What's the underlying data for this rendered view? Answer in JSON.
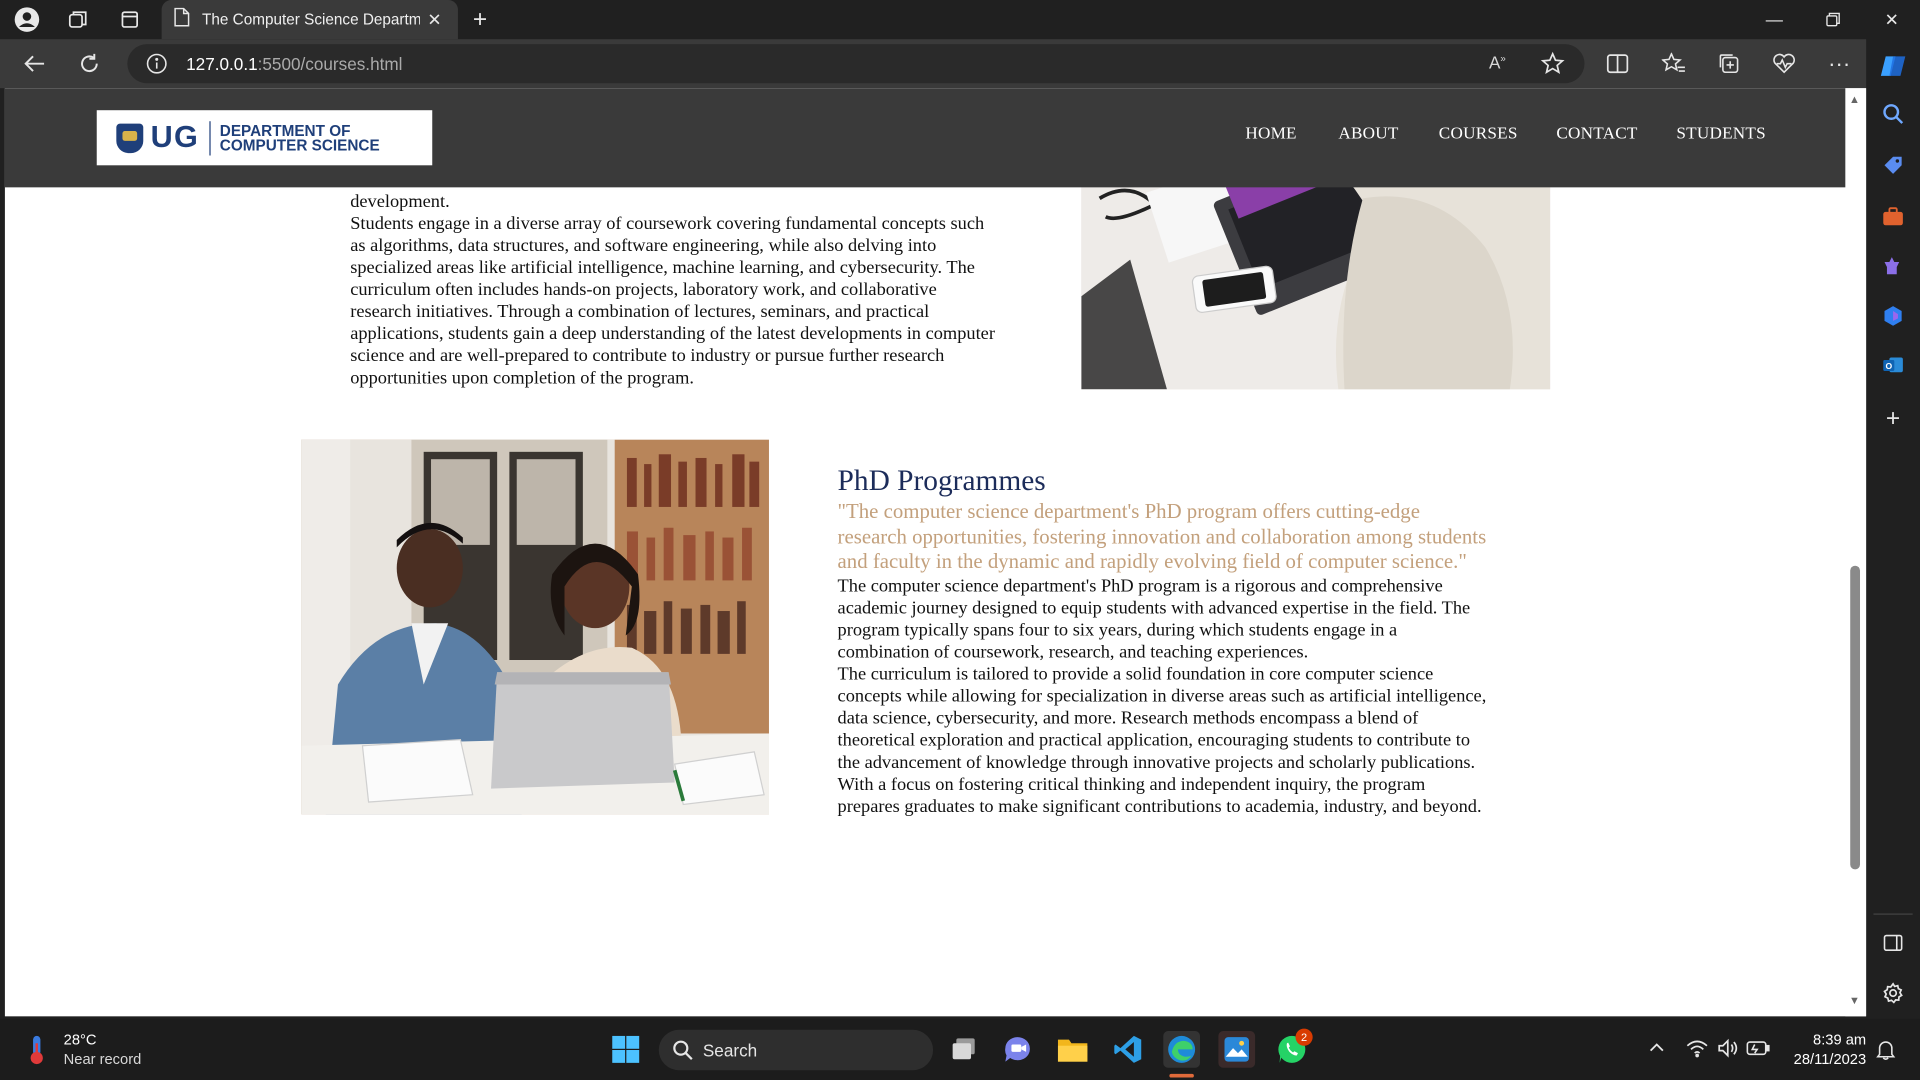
{
  "browser": {
    "tab_title": "The Computer Science Departme",
    "url_host": "127.0.0.1",
    "url_rest": ":5500/courses.html"
  },
  "site": {
    "logo_abbrev": "UG",
    "logo_line1": "DEPARTMENT OF",
    "logo_line2": "COMPUTER SCIENCE",
    "nav": [
      "HOME",
      "ABOUT",
      "COURSES",
      "CONTACT",
      "STUDENTS"
    ]
  },
  "masters_section": {
    "lines": [
      "development.",
      "Students engage in a diverse array of coursework covering fundamental concepts such",
      "as algorithms, data structures, and software engineering, while also delving into",
      "specialized areas like artificial intelligence, machine learning, and cybersecurity. The",
      "curriculum often includes hands-on projects, laboratory work, and collaborative",
      "research initiatives. Through a combination of lectures, seminars, and practical",
      "applications, students gain a deep understanding of the latest developments in computer",
      "science and are well-prepared to contribute to industry or pursue further research",
      "opportunities upon completion of the program."
    ]
  },
  "phd_section": {
    "title": "PhD Programmes",
    "quote_lines": [
      "\"The computer science department's PhD program offers cutting-edge",
      "research opportunities, fostering innovation and collaboration among students",
      "and faculty in the dynamic and rapidly evolving field of computer science.\""
    ],
    "body_lines": [
      "The computer science department's PhD program is a rigorous and comprehensive",
      "academic journey designed to equip students with advanced expertise in the field. The",
      "program typically spans four to six years, during which students engage in a",
      "combination of coursework, research, and teaching experiences.",
      "The curriculum is tailored to provide a solid foundation in core computer science",
      "concepts while allowing for specialization in diverse areas such as artificial intelligence,",
      "data science, cybersecurity, and more. Research methods encompass a blend of",
      "theoretical exploration and practical application, encouraging students to contribute to",
      "the advancement of knowledge through innovative projects and scholarly publications.",
      "With a focus on fostering critical thinking and independent inquiry, the program",
      "prepares graduates to make significant contributions to academia, industry, and beyond."
    ]
  },
  "taskbar": {
    "temperature": "28°C",
    "weather_desc": "Near record",
    "search_label": "Search",
    "time": "8:39 am",
    "date": "28/11/2023",
    "whatsapp_badge": "2"
  },
  "colors": {
    "nav_bg": "#3a3a3a",
    "phd_title": "#1c2c5a",
    "phd_quote": "#c3a07c"
  }
}
